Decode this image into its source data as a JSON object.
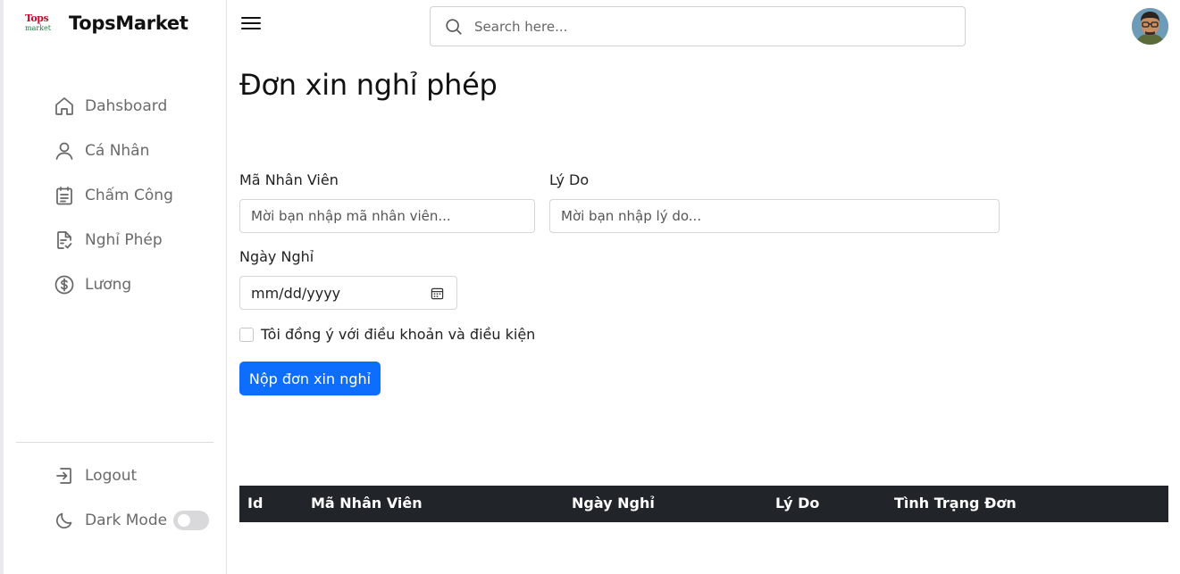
{
  "brand": {
    "logo_line1": "Tops",
    "logo_line2": "market",
    "name": "TopsMarket"
  },
  "sidebar": {
    "items": [
      {
        "label": "Dahsboard",
        "icon": "home-icon"
      },
      {
        "label": "Cá Nhân",
        "icon": "user-icon"
      },
      {
        "label": "Chấm Công",
        "icon": "clipboard-icon"
      },
      {
        "label": "Nghỉ Phép",
        "icon": "document-check-icon"
      },
      {
        "label": "Lương",
        "icon": "dollar-circle-icon"
      }
    ],
    "logout_label": "Logout",
    "dark_mode_label": "Dark Mode",
    "dark_mode_on": false
  },
  "header": {
    "search_placeholder": "Search here..."
  },
  "page": {
    "title": "Đơn xin nghỉ phép"
  },
  "form": {
    "employee_id_label": "Mã Nhân Viên",
    "employee_id_placeholder": "Mời bạn nhập mã nhân viên...",
    "reason_label": "Lý Do",
    "reason_placeholder": "Mời bạn nhập lý do...",
    "date_label": "Ngày Nghỉ",
    "date_placeholder": "mm/dd/yyyy",
    "agree_label": "Tôi đồng ý với điều khoản và điều kiện",
    "agree_checked": false,
    "submit_label": "Nộp đơn xin nghỉ"
  },
  "table": {
    "columns": [
      "Id",
      "Mã Nhân Viên",
      "Ngày Nghỉ",
      "Lý Do",
      "Tình Trạng Đơn"
    ],
    "rows": []
  },
  "colors": {
    "primary": "#0d6efd",
    "table_header_bg": "#212529",
    "background": "#e9eaee"
  }
}
